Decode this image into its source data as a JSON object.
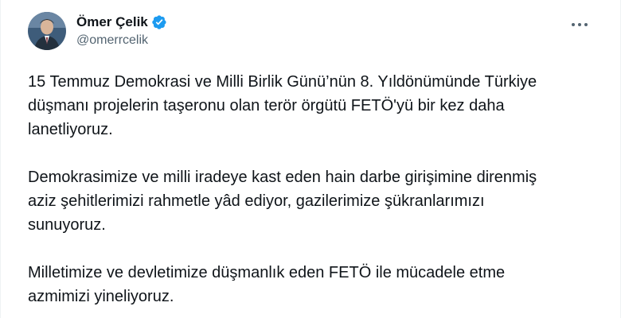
{
  "author": {
    "display_name": "Ömer Çelik",
    "handle": "@omerrcelik",
    "verified_badge_color": "#1d9bf0"
  },
  "menu": {
    "icon": "more-horizontal-icon"
  },
  "tweet": {
    "lines": [
      "15 Temmuz Demokrasi ve Milli Birlik Günü’nün 8. Yıldönümünde Türkiye",
      "düşmanı projelerin taşeronu olan terör örgütü FETÖ'yü bir kez daha",
      "lanetliyoruz.",
      "Demokrasimize ve milli iradeye kast eden hain darbe girişimine direnmiş",
      "aziz şehitlerimizi rahmetle yâd ediyor, gazilerimize şükranlarımızı",
      "sunuyoruz.",
      "Milletimize ve devletimize düşmanlık eden FETÖ ile mücadele etme",
      "azmimizi yineliyoruz."
    ]
  },
  "colors": {
    "text": "#0f1419",
    "secondary": "#536471",
    "accent": "#1d9bf0"
  }
}
